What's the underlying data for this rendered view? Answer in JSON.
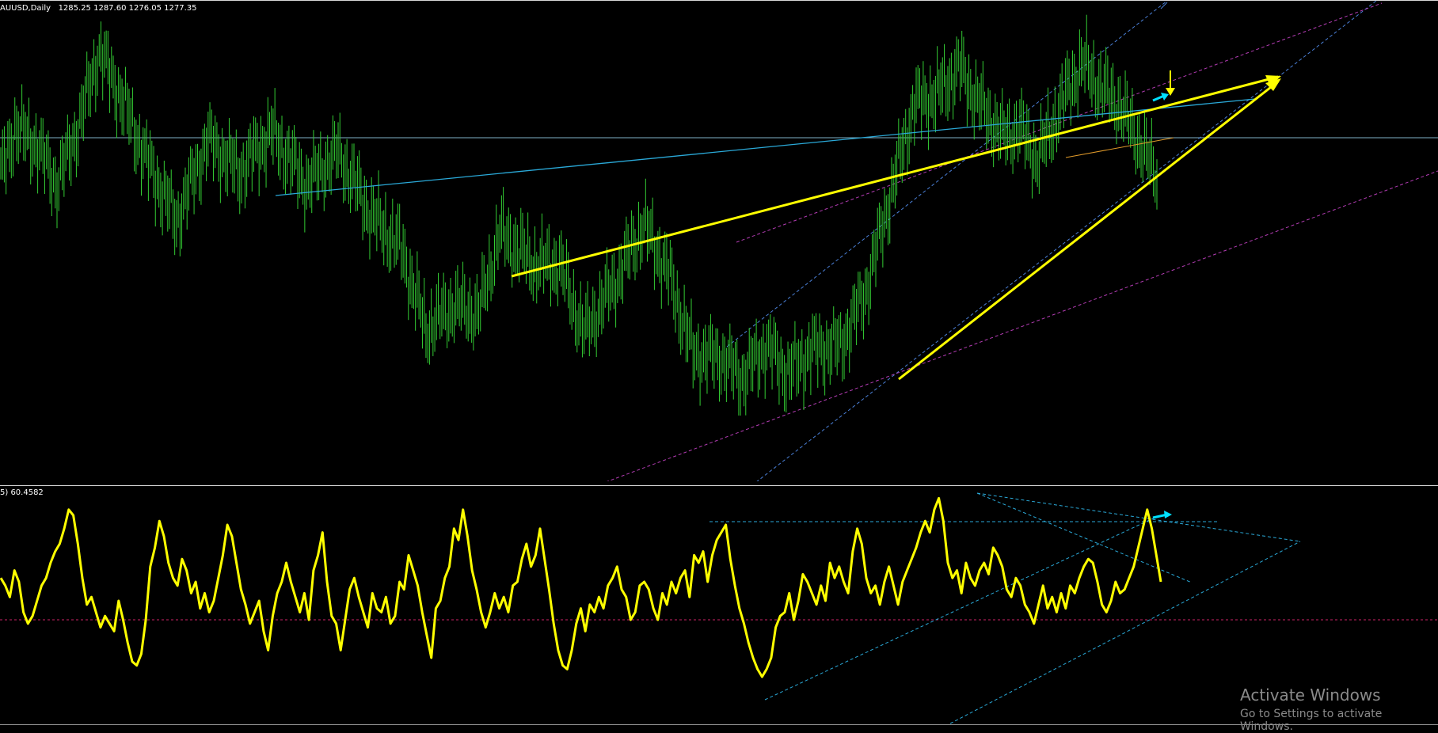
{
  "chart_data": [
    {
      "type": "bar",
      "subtype": "ohlc",
      "symbol_label": "AUUSD,Daily",
      "ohlc_label": "1285.25 1287.60 1276.05 1277.35",
      "colors": {
        "background": "#000000",
        "bars": "#33cc33",
        "horizontal_line": "#7fb2c9"
      },
      "waypoints": [
        [
          0,
          1272
        ],
        [
          8,
          1284
        ],
        [
          20,
          1280
        ],
        [
          32,
          1270
        ],
        [
          44,
          1284
        ],
        [
          56,
          1303
        ],
        [
          68,
          1292
        ],
        [
          82,
          1277
        ],
        [
          100,
          1261
        ],
        [
          118,
          1281
        ],
        [
          136,
          1273
        ],
        [
          154,
          1283
        ],
        [
          174,
          1270
        ],
        [
          192,
          1278
        ],
        [
          210,
          1263
        ],
        [
          228,
          1254
        ],
        [
          242,
          1234
        ],
        [
          258,
          1240
        ],
        [
          272,
          1238
        ],
        [
          284,
          1258
        ],
        [
          304,
          1250
        ],
        [
          318,
          1250
        ],
        [
          332,
          1233
        ],
        [
          350,
          1246
        ],
        [
          366,
          1260
        ],
        [
          380,
          1248
        ],
        [
          394,
          1228
        ],
        [
          410,
          1227
        ],
        [
          422,
          1222
        ],
        [
          436,
          1230
        ],
        [
          448,
          1223
        ],
        [
          462,
          1229
        ],
        [
          478,
          1230
        ],
        [
          492,
          1243
        ],
        [
          508,
          1270
        ],
        [
          520,
          1290
        ],
        [
          532,
          1292
        ],
        [
          546,
          1299
        ],
        [
          554,
          1292
        ],
        [
          570,
          1282
        ],
        [
          580,
          1284
        ],
        [
          590,
          1276
        ],
        [
          600,
          1286
        ],
        [
          608,
          1294
        ],
        [
          616,
          1300
        ],
        [
          626,
          1294
        ],
        [
          636,
          1290
        ],
        [
          646,
          1282
        ],
        [
          658,
          1272
        ]
      ]
    },
    {
      "type": "line",
      "indicator_label": "5) 60.4582",
      "ylim": [
        0,
        100
      ],
      "reference_level": 40,
      "colors": {
        "line": "#ffff00",
        "reference_line": "#cc2266"
      },
      "series": [
        {
          "values": [
            62,
            58,
            52,
            66,
            60,
            44,
            38,
            42,
            50,
            58,
            62,
            70,
            76,
            80,
            88,
            98,
            95,
            80,
            62,
            48,
            52,
            44,
            36,
            42,
            38,
            34,
            50,
            40,
            28,
            18,
            16,
            22,
            40,
            68,
            78,
            92,
            84,
            70,
            62,
            58,
            72,
            66,
            54,
            60,
            46,
            54,
            44,
            50,
            62,
            74,
            90,
            84,
            70,
            56,
            48,
            38,
            44,
            50,
            34,
            24,
            42,
            54,
            60,
            70,
            60,
            52,
            44,
            54,
            40,
            66,
            74,
            86,
            60,
            42,
            38,
            24,
            40,
            56,
            62,
            52,
            44,
            36,
            54,
            46,
            44,
            52,
            38,
            42,
            60,
            56,
            74,
            66,
            58,
            44,
            32,
            20,
            46,
            50,
            62,
            68,
            88,
            82,
            98,
            84,
            66,
            56,
            44,
            36,
            44,
            54,
            46,
            52,
            44,
            58,
            60,
            72,
            80,
            68,
            74,
            88,
            72,
            56,
            38,
            24,
            16,
            14,
            24,
            38,
            46,
            34,
            48,
            44,
            52,
            46,
            58,
            62,
            68,
            56,
            52,
            40,
            44,
            58,
            60,
            56,
            46,
            40,
            54,
            48,
            60,
            54,
            62,
            66,
            52,
            74,
            70,
            76,
            60,
            74,
            82,
            86,
            90,
            72,
            58,
            46,
            38,
            28,
            20,
            14,
            10,
            14,
            20,
            36,
            42,
            44,
            54,
            40,
            50,
            64,
            60,
            54,
            48,
            58,
            50,
            70,
            62,
            68,
            60,
            54,
            76,
            88,
            80,
            62,
            54,
            58,
            48,
            60,
            68,
            58,
            48,
            60,
            66,
            72,
            78,
            86,
            92,
            86,
            98,
            104,
            92,
            70,
            62,
            66,
            54,
            70,
            62,
            58,
            66,
            70,
            64,
            78,
            74,
            68,
            56,
            52,
            62,
            58,
            48,
            44,
            38,
            48,
            58,
            46,
            52,
            44,
            54,
            46,
            58,
            54,
            62,
            68,
            72,
            70,
            60,
            48,
            44,
            50,
            60,
            54,
            56,
            62,
            68,
            78,
            88,
            98,
            88,
            74,
            60
          ]
        }
      ]
    }
  ],
  "watermark": {
    "title": "Activate Windows",
    "subtitle": "Go to Settings to activate Windows."
  }
}
